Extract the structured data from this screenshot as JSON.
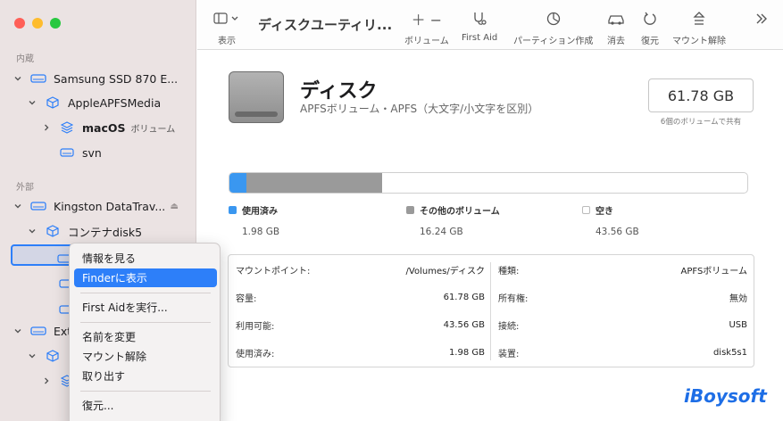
{
  "sidebar": {
    "section_internal": "内蔵",
    "section_external": "外部",
    "items": [
      {
        "label": "Samsung SSD 870 E..."
      },
      {
        "label": "AppleAPFSMedia"
      },
      {
        "label": "macOS",
        "note": "ボリューム"
      },
      {
        "label": "svn"
      },
      {
        "label": "Kingston DataTrav..."
      },
      {
        "label": "コンテナdisk5"
      },
      {
        "label": "Ext"
      }
    ]
  },
  "toolbar": {
    "view_label": "表示",
    "title": "ディスクユーティリ...",
    "volume_label": "ボリューム",
    "firstaid_label": "First Aid",
    "partition_label": "パーティション作成",
    "erase_label": "消去",
    "restore_label": "復元",
    "unmount_label": "マウント解除"
  },
  "disk": {
    "title": "ディスク",
    "subtitle": "APFSボリューム・APFS（大文字/小文字を区別）",
    "capacity": "61.78 GB",
    "capacity_note": "6個のボリュームで共有"
  },
  "usage": {
    "used_fraction": 0.032,
    "other_fraction": 0.263,
    "used_label": "使用済み",
    "used_value": "1.98 GB",
    "other_label": "その他のボリューム",
    "other_value": "16.24 GB",
    "free_label": "空き",
    "free_value": "43.56 GB",
    "used_color": "#3a97f0",
    "other_color": "#9a9a9a"
  },
  "info_left": [
    {
      "k": "マウントポイント:",
      "v": "/Volumes/ディスク"
    },
    {
      "k": "容量:",
      "v": "61.78 GB"
    },
    {
      "k": "利用可能:",
      "v": "43.56 GB"
    },
    {
      "k": "使用済み:",
      "v": "1.98 GB"
    }
  ],
  "info_right": [
    {
      "k": "種類:",
      "v": "APFSボリューム"
    },
    {
      "k": "所有権:",
      "v": "無効"
    },
    {
      "k": "接続:",
      "v": "USB"
    },
    {
      "k": "装置:",
      "v": "disk5s1"
    }
  ],
  "context_menu": {
    "items": [
      {
        "label": "情報を見る"
      },
      {
        "label": "Finderに表示"
      },
      {
        "label": "First Aidを実行..."
      },
      {
        "label": "名前を変更"
      },
      {
        "label": "マウント解除"
      },
      {
        "label": "取り出す"
      },
      {
        "label": "復元..."
      }
    ]
  },
  "brand": "iBoysoft"
}
